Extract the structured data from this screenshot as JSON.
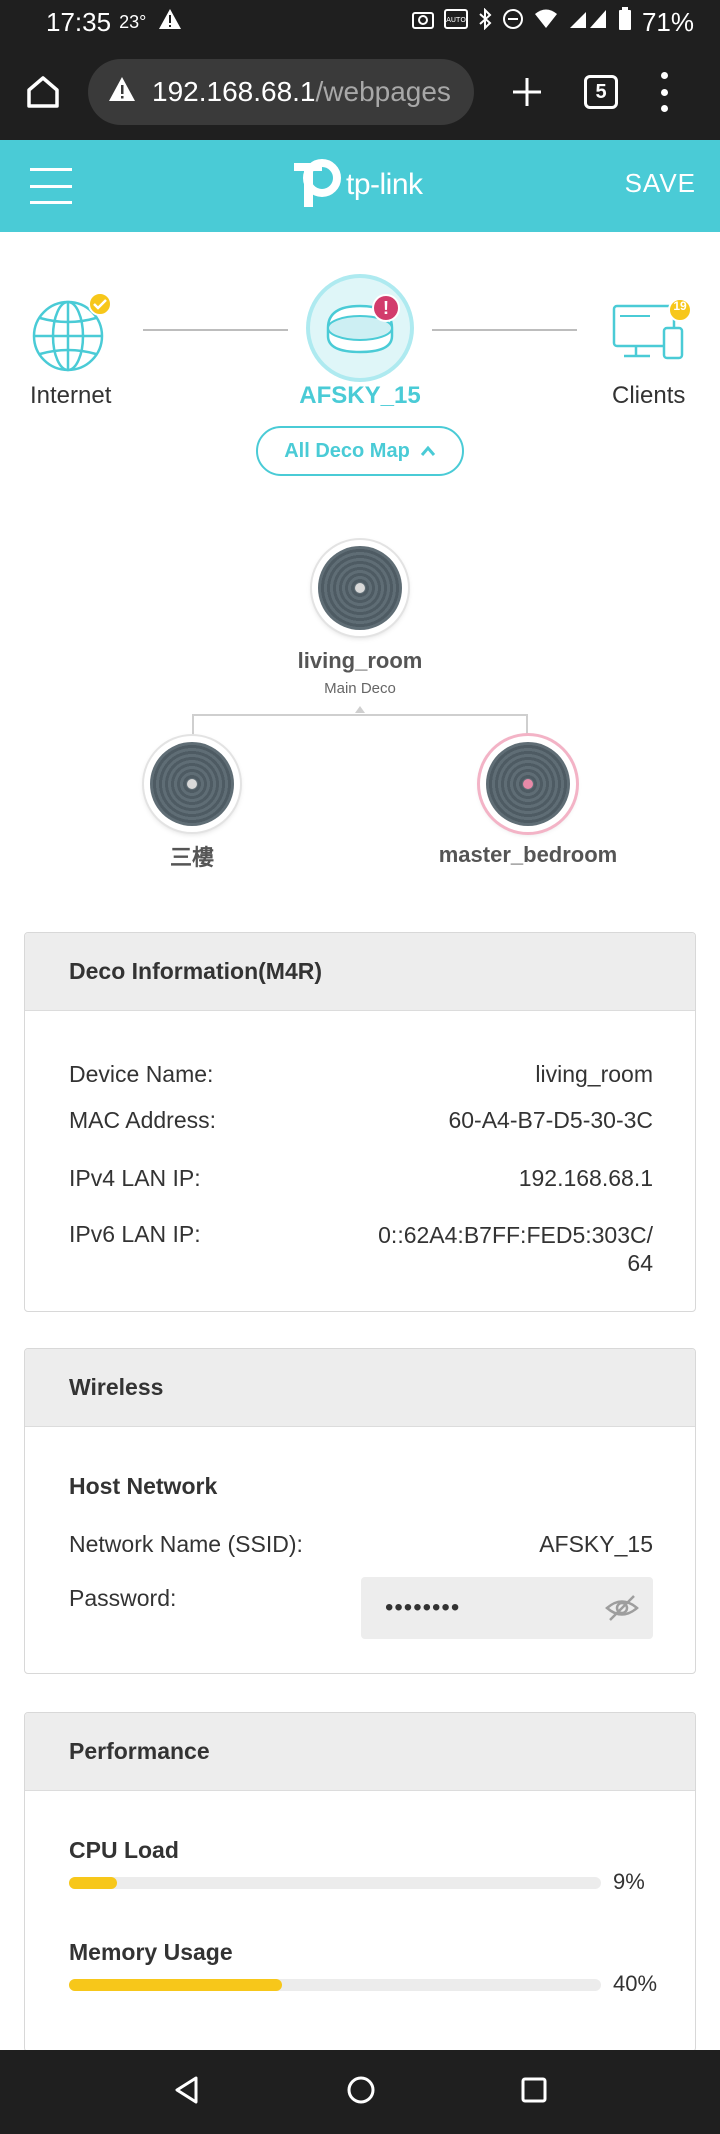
{
  "status_bar": {
    "time": "17:35",
    "temperature": "23°",
    "battery": "71%",
    "icons": [
      "warning-icon",
      "camera-icon",
      "auto-icon",
      "bluetooth-icon",
      "dnd-icon",
      "wifi-icon",
      "signal-icon",
      "battery-icon"
    ]
  },
  "browser": {
    "url_host": "192.168.68.1",
    "url_path": "/webpages",
    "tab_count": "5"
  },
  "header": {
    "logo_text": "tp-link",
    "save_label": "SAVE",
    "accent_color": "#4acbd6"
  },
  "topology": {
    "internet_label": "Internet",
    "router_name": "AFSKY_15",
    "router_alert": "!",
    "clients_label": "Clients",
    "clients_count": "19",
    "map_button_label": "All Deco Map"
  },
  "deco_map": {
    "main": {
      "name": "living_room",
      "role": "Main Deco"
    },
    "satellites": [
      {
        "name": "三樓"
      },
      {
        "name": "master_bedroom"
      }
    ]
  },
  "deco_info": {
    "title": "Deco Information(M4R)",
    "rows": [
      {
        "label": "Device Name:",
        "value": "living_room"
      },
      {
        "label": "MAC Address:",
        "value": "60-A4-B7-D5-30-3C"
      },
      {
        "label": "IPv4 LAN IP:",
        "value": "192.168.68.1"
      },
      {
        "label": "IPv6 LAN IP:",
        "value_line1": "0::62A4:B7FF:FED5:303C/",
        "value_line2": "64"
      }
    ]
  },
  "wireless": {
    "title": "Wireless",
    "subheading": "Host Network",
    "ssid_label": "Network Name (SSID):",
    "ssid_value": "AFSKY_15",
    "password_label": "Password:",
    "password_value": "••••••••"
  },
  "performance": {
    "title": "Performance",
    "cpu_label": "CPU Load",
    "cpu_percent_text": "9%",
    "cpu_fraction": 0.09,
    "memory_label": "Memory Usage",
    "memory_percent_text": "40%",
    "memory_fraction": 0.4,
    "bar_color": "#f7c71a"
  }
}
